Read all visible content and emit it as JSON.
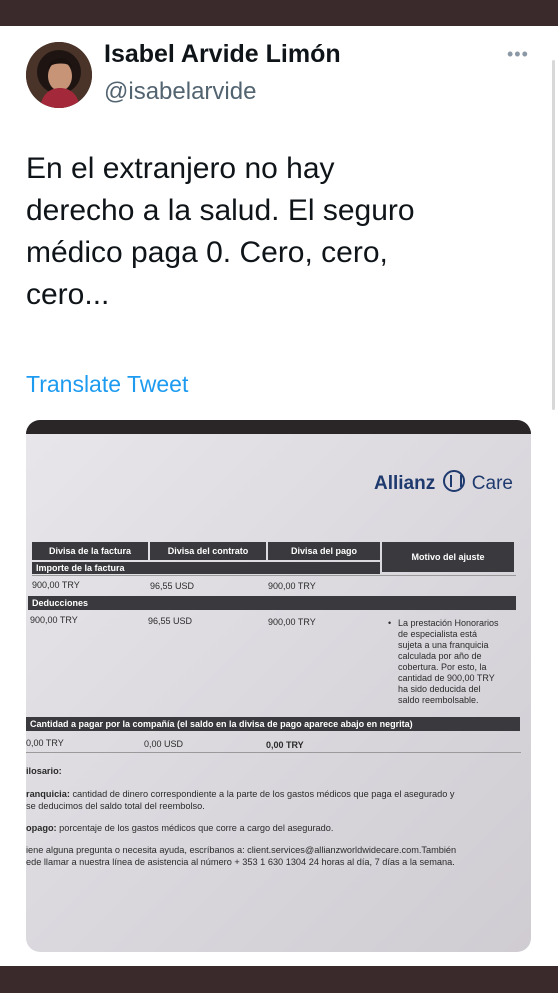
{
  "tweet": {
    "display_name": "Isabel Arvide Limón",
    "handle": "@isabelarvide",
    "more_icon": "more-icon",
    "text": "En el extranjero no hay\nderecho a la salud. El seguro\nmédico paga 0.  Cero, cero,\ncero...",
    "translate_label": "Translate Tweet"
  },
  "document": {
    "brand_left": "Allianz",
    "brand_right": "Care",
    "headers": [
      "Divisa de la factura",
      "Divisa del contrato",
      "Divisa del pago",
      "Motivo del ajuste"
    ],
    "importe_label": "Importe de la factura",
    "importe_row": [
      "900,00 TRY",
      "96,55 USD",
      "900,00 TRY"
    ],
    "deducciones_label": "Deducciones",
    "deducciones_row": [
      "900,00 TRY",
      "96,55 USD",
      "900,00 TRY"
    ],
    "motivo_text": "La prestación Honorarios\nde especialista está\nsujeta a una franquicia\ncalculada por año de\ncobertura. Por esto, la\ncantidad de 900,00 TRY\nha sido deducida del\nsaldo reembolsable.",
    "pagar_label": "Cantidad a pagar por la compañía (el saldo en la divisa de pago aparece abajo en negrita)",
    "pagar_row": [
      "0,00 TRY",
      "0,00 USD",
      "0,00 TRY"
    ],
    "glosario_title": "ilosario:",
    "franquicia_term": "ranquicia:",
    "franquicia_text": " cantidad de dinero correspondiente a la parte de los gastos médicos que paga el asegurado y\nse deducimos del saldo total del reembolso.",
    "copago_term": "opago:",
    "copago_text": " porcentaje de los gastos médicos que corre a cargo del asegurado.",
    "contacto_text": "iene alguna pregunta o necesita ayuda, escríbanos a: client.services@allianzworldwidecare.com.También\nede llamar a nuestra línea de asistencia al número + 353 1 630 1304 24 horas al día, 7 días a la semana."
  }
}
